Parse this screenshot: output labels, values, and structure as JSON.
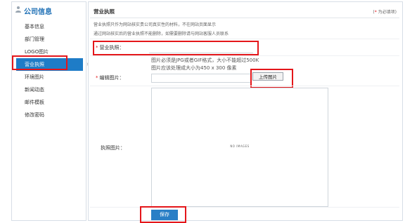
{
  "sidebar": {
    "title": "公司信息",
    "items": [
      {
        "label": "基本信息"
      },
      {
        "label": "部门管理"
      },
      {
        "label": "LOGO图片"
      },
      {
        "label": "营业执照",
        "active": true
      },
      {
        "label": "环境图片"
      },
      {
        "label": "新闻动态"
      },
      {
        "label": "邮件模板"
      },
      {
        "label": "修改密码"
      }
    ]
  },
  "main": {
    "title": "营业执照",
    "required_star": "*",
    "required_note": "为必填项)",
    "note1": "营业执照只作为网站核实贵公司真实性的材料，不在网站页面显示",
    "note2": "通过网站核实后的营业执照不能删除，如需要删除请与网站客服人员联系",
    "license_star": "*",
    "license_label": "营业执照：",
    "edit_star": "*",
    "edit_label": "编辑图片：",
    "hint1": "图片必须是JPG或者GIF格式，大小不能超过500K",
    "hint2": "图片应该处理成大小为450 x 300 像素",
    "upload_button": "上传图片",
    "preview_label": "执照图片：",
    "preview_placeholder": "NO IMAGES",
    "save_button": "保存"
  },
  "colors": {
    "accent": "#1e7cc7",
    "highlight": "#e4161a",
    "required": "#e4161a"
  }
}
